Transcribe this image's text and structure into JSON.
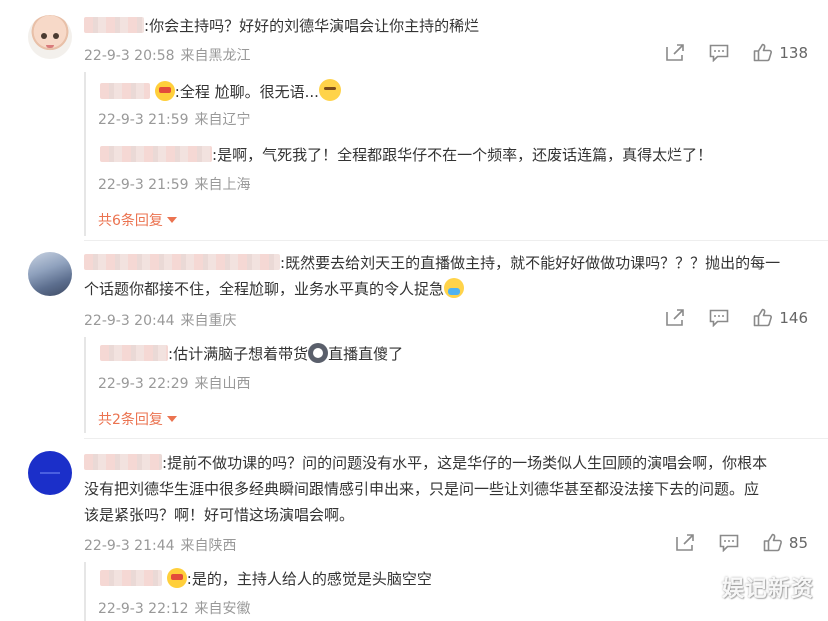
{
  "comments": [
    {
      "text": "你会主持吗？好好的刘德华演唱会让你主持的稀烂",
      "time": "22-9-3 20:58",
      "location": "来自黑龙江",
      "likes": "138",
      "replies": [
        {
          "text_before": "全程 尬聊。很无语...",
          "emoji": "thinking-face",
          "time": "22-9-3 21:59",
          "location": "来自辽宁"
        },
        {
          "text_before": "是啊，气死我了！全程都跟华仔不在一个频率，还废话连篇，真得太烂了！",
          "time": "22-9-3 21:59",
          "location": "来自上海"
        }
      ],
      "more_replies": "共6条回复"
    },
    {
      "text_line1": "既然要去给刘天王的直播做主持，就不能好好做做功课吗？？？抛出的每一",
      "text_line2": "个话题你都接不住，全程尬聊，业务水平真的令人捉急",
      "time": "22-9-3 20:44",
      "location": "来自重庆",
      "likes": "146",
      "replies": [
        {
          "text_before": "估计满脑子想着带货",
          "text_after": "直播直傻了",
          "time": "22-9-3 22:29",
          "location": "来自山西"
        }
      ],
      "more_replies": "共2条回复"
    },
    {
      "text_line1": "提前不做功课的吗？问的问题没有水平，这是华仔的一场类似人生回顾的演唱会啊，你根本",
      "text_line2": "没有把刘德华生涯中很多经典瞬间跟情感引申出来，只是问一些让刘德华甚至都没法接下去的问题。应",
      "text_line3": "该是紧张吗？啊！好可惜这场演唱会啊。",
      "time": "22-9-3 21:44",
      "location": "来自陕西",
      "likes": "85",
      "replies": [
        {
          "text_before": "是的，主持人给人的感觉是头脑空空",
          "time": "22-9-3 22:12",
          "location": "来自安徽"
        }
      ]
    }
  ],
  "watermark": "娱记新资",
  "colors": {
    "accent": "#eb7350",
    "meta": "#999999",
    "text": "#333333"
  }
}
